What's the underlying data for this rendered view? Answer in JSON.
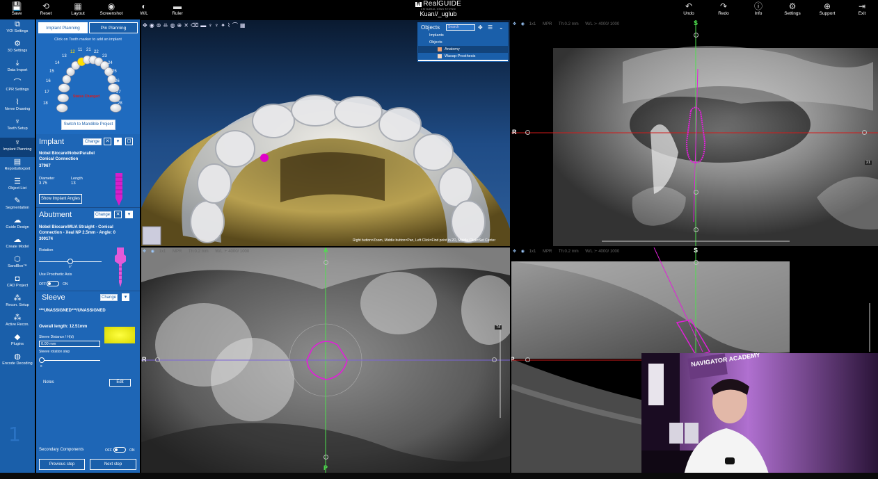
{
  "toolbar": {
    "left": [
      {
        "label": "Save",
        "icon": "save-icon"
      },
      {
        "label": "Reset",
        "icon": "reset-icon"
      },
      {
        "label": "Layout",
        "icon": "layout-icon"
      },
      {
        "label": "Screenshot",
        "icon": "camera-icon"
      },
      {
        "label": "W/L",
        "icon": "window-level-icon"
      },
      {
        "label": "Ruler",
        "icon": "ruler-icon"
      }
    ],
    "right": [
      {
        "label": "Undo",
        "icon": "undo-icon"
      },
      {
        "label": "Redo",
        "icon": "redo-icon"
      },
      {
        "label": "Info",
        "icon": "info-icon"
      },
      {
        "label": "Settings",
        "icon": "gear-icon"
      },
      {
        "label": "Support",
        "icon": "globe-icon"
      },
      {
        "label": "Exit",
        "icon": "exit-icon"
      }
    ],
    "brand": "RealGUIDE",
    "brand_sub": "UNIVERSAL OPEN SYSTEM",
    "patient": "Kuan//_uglub"
  },
  "nav": {
    "items": [
      {
        "label": "VOI Settings",
        "icon": "voi-icon"
      },
      {
        "label": "3D Settings",
        "icon": "settings-3d-icon"
      },
      {
        "label": "Data Import",
        "icon": "import-icon"
      },
      {
        "label": "CPR Settings",
        "icon": "cpr-icon"
      },
      {
        "label": "Nerve Drawing",
        "icon": "nerve-icon"
      },
      {
        "label": "Teeth Setup",
        "icon": "tooth-icon"
      },
      {
        "label": "Implant Planning",
        "icon": "implant-icon"
      },
      {
        "label": "Reports/Export",
        "icon": "report-icon"
      },
      {
        "label": "Object List",
        "icon": "list-icon"
      },
      {
        "label": "Segmentation",
        "icon": "segmentation-icon"
      },
      {
        "label": "Guide Design",
        "icon": "guide-icon"
      },
      {
        "label": "Create Model",
        "icon": "model-icon"
      },
      {
        "label": "SandBox™",
        "icon": "sandbox-icon"
      },
      {
        "label": "CAD Project",
        "icon": "cad-icon"
      },
      {
        "label": "Recon. Setup",
        "icon": "recon-icon"
      },
      {
        "label": "Active Recon.",
        "icon": "active-recon-icon"
      },
      {
        "label": "Plugins",
        "icon": "plugin-icon"
      },
      {
        "label": "Encode Decoding",
        "icon": "encode-icon"
      }
    ],
    "active_index": 6,
    "step_number": "1"
  },
  "panel": {
    "tab_implant": "Implant Planning",
    "tab_pin": "Pin Planning",
    "hint": "Click on Tooth marker to add an implant",
    "tooth_numbers": [
      "18",
      "17",
      "16",
      "15",
      "14",
      "13",
      "12",
      "11",
      "21",
      "22",
      "23",
      "24",
      "25",
      "26",
      "27",
      "28"
    ],
    "selected_tooth": "12",
    "chart_status": "Status Changed",
    "switch_button": "Switch to Mandible Project",
    "implant": {
      "title": "Implant",
      "change": "Change",
      "name": "Nobel Biocare/NobelParallel Conical Connection",
      "code": "37967",
      "diameter_label": "Diameter",
      "diameter": "3.75",
      "length_label": "Length",
      "length": "13",
      "show_angles": "Show Implant Angles"
    },
    "abutment": {
      "title": "Abutment",
      "change": "Change",
      "name": "Nobel Biocare/MUA Straight - Conical Connection - Xeal NP 2.5mm - Angle: 0",
      "code": "300174",
      "rotation_label": "Rotation",
      "rotation_value": "0°",
      "prosthetic_axis": "Use Prosthetic Axis",
      "off": "OFF",
      "on": "ON"
    },
    "sleeve": {
      "title": "Sleeve",
      "change": "Change",
      "assignment": "***UNASSIGNED***/UNASSIGNED",
      "overall_length": "Overall length: 12.51mm",
      "distance_label": "Sleeve Distance / H(d)",
      "distance_value": "0.00 mm",
      "rotation_step_label": "Sleeve rotation step",
      "rotation_step_value": "0",
      "notes": "Notes",
      "edit": "Edit",
      "color": "#f2f200"
    },
    "secondary": {
      "label": "Secondary Components",
      "off": "OFF",
      "on": "ON"
    },
    "prev": "Previous step",
    "next": "Next step"
  },
  "objects_window": {
    "title": "Objects",
    "search_placeholder": "Search",
    "rows": [
      {
        "label": "Implants",
        "color": "#ffffff"
      },
      {
        "label": "Objects",
        "color": "#ffffff"
      },
      {
        "label": "Anatomy",
        "color": "#f0a070"
      },
      {
        "label": "Wasap-Prosthesis",
        "color": "#f8d8c0"
      }
    ]
  },
  "viewports": {
    "toolbar_labels": [
      "1x1",
      "MPR",
      "Th:0.2 mm",
      "W/L :+ 4000/ 1000"
    ],
    "orient": {
      "superior": "S",
      "right": "R",
      "anterior": "A",
      "posterior": "P",
      "left_posterior": "LP"
    },
    "slice_top_right": "21",
    "slice_bottom_left": "74",
    "status_3d": "Right button=Zoom, Middle button=Pan, Left Click=Find point in 2D, Middle Click=Set Center",
    "accent_magenta": "#e020d8"
  },
  "webcam": {
    "sign": "NAVIGATOR ACADEMY"
  }
}
